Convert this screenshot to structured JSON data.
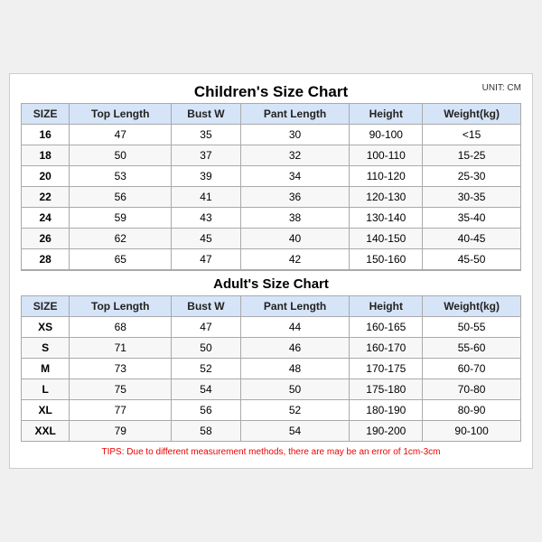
{
  "chart": {
    "title": "Children's Size Chart",
    "unit": "UNIT: CM",
    "children_headers": [
      "SIZE",
      "Top Length",
      "Bust W",
      "Pant Length",
      "Height",
      "Weight(kg)"
    ],
    "children_rows": [
      [
        "16",
        "47",
        "35",
        "30",
        "90-100",
        "<15"
      ],
      [
        "18",
        "50",
        "37",
        "32",
        "100-110",
        "15-25"
      ],
      [
        "20",
        "53",
        "39",
        "34",
        "110-120",
        "25-30"
      ],
      [
        "22",
        "56",
        "41",
        "36",
        "120-130",
        "30-35"
      ],
      [
        "24",
        "59",
        "43",
        "38",
        "130-140",
        "35-40"
      ],
      [
        "26",
        "62",
        "45",
        "40",
        "140-150",
        "40-45"
      ],
      [
        "28",
        "65",
        "47",
        "42",
        "150-160",
        "45-50"
      ]
    ],
    "adult_title": "Adult's Size Chart",
    "adult_headers": [
      "SIZE",
      "Top Length",
      "Bust W",
      "Pant Length",
      "Height",
      "Weight(kg)"
    ],
    "adult_rows": [
      [
        "XS",
        "68",
        "47",
        "44",
        "160-165",
        "50-55"
      ],
      [
        "S",
        "71",
        "50",
        "46",
        "160-170",
        "55-60"
      ],
      [
        "M",
        "73",
        "52",
        "48",
        "170-175",
        "60-70"
      ],
      [
        "L",
        "75",
        "54",
        "50",
        "175-180",
        "70-80"
      ],
      [
        "XL",
        "77",
        "56",
        "52",
        "180-190",
        "80-90"
      ],
      [
        "XXL",
        "79",
        "58",
        "54",
        "190-200",
        "90-100"
      ]
    ],
    "tips": "TIPS: Due to different measurement methods, there are may be an error of 1cm-3cm"
  }
}
